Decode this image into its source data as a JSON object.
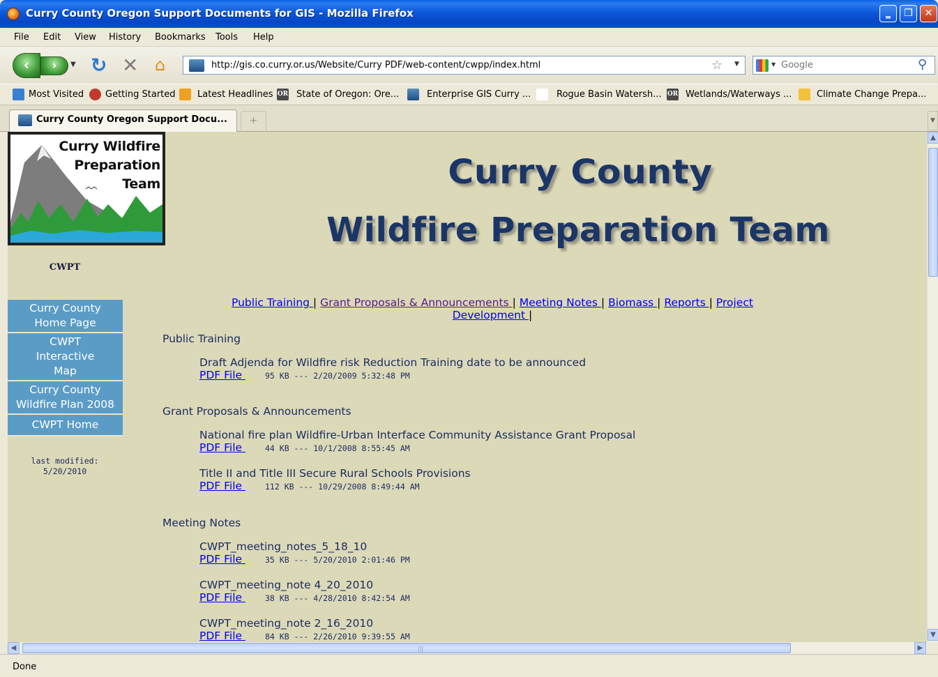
{
  "window": {
    "title": "Curry County Oregon Support Documents for GIS - Mozilla Firefox",
    "minimize": "‗",
    "maximize": "❐",
    "close": "✕"
  },
  "menu": [
    "File",
    "Edit",
    "View",
    "History",
    "Bookmarks",
    "Tools",
    "Help"
  ],
  "nav": {
    "url": "http://gis.co.curry.or.us/Website/Curry PDF/web-content/cwpp/index.html",
    "search_placeholder": "Google"
  },
  "bookmarks": [
    {
      "label": "Most Visited",
      "icon": "most-visited-icon"
    },
    {
      "label": "Getting Started",
      "icon": "firefox-icon"
    },
    {
      "label": "Latest Headlines",
      "icon": "rss-icon"
    },
    {
      "label": "State of Oregon: Ore...",
      "icon": "oregon-icon"
    },
    {
      "label": "Enterprise GIS Curry ...",
      "icon": "gis-icon"
    },
    {
      "label": "Rogue Basin Watersh...",
      "icon": "blank-icon"
    },
    {
      "label": "Wetlands/Waterways ...",
      "icon": "oregon-icon"
    },
    {
      "label": "Climate Change Prepa...",
      "icon": "climate-icon"
    }
  ],
  "tabs": [
    {
      "label": "Curry County Oregon Support Docu...",
      "active": true
    }
  ],
  "page": {
    "logo": {
      "line1": "Curry Wildfire",
      "line2": "Preparation",
      "line3": "Team"
    },
    "cwpt_label": "CWPT",
    "left_nav": [
      "Curry County Home Page",
      "CWPT Interactive Map",
      "Curry County Wildfire Plan 2008",
      "CWPT Home"
    ],
    "last_modified_label": "last modified:",
    "last_modified_date": "5/20/2010",
    "heading_line1": "Curry County",
    "heading_line2": "Wildfire Preparation Team",
    "top_nav": [
      "Public Training ",
      "Grant Proposals & Announcements ",
      "Meeting Notes ",
      "Biomass ",
      "Reports ",
      "Project Development "
    ],
    "separator": "|",
    "sections": [
      {
        "title": "Public Training",
        "docs": [
          {
            "title": "Draft Adjenda for Wildfire risk Reduction Training date to be announced",
            "link": "PDF File ",
            "meta": "95 KB --- 2/20/2009 5:32:48 PM"
          }
        ]
      },
      {
        "title": "Grant Proposals & Announcements",
        "docs": [
          {
            "title": "National fire plan Wildfire-Urban Interface Community Assistance Grant Proposal",
            "link": "PDF File ",
            "meta": "44 KB --- 10/1/2008 8:55:45 AM"
          },
          {
            "title": "Title II and Title III Secure Rural Schools Provisions",
            "link": "PDF File ",
            "meta": "112 KB --- 10/29/2008 8:49:44 AM"
          }
        ]
      },
      {
        "title": "Meeting Notes",
        "docs": [
          {
            "title": "CWPT_meeting_notes_5_18_10",
            "link": "PDF File ",
            "meta": "35 KB --- 5/20/2010 2:01:46 PM"
          },
          {
            "title": "CWPT_meeting_note 4_20_2010",
            "link": "PDF File ",
            "meta": "38 KB --- 4/28/2010 8:42:54 AM"
          },
          {
            "title": "CWPT_meeting_note 2_16_2010",
            "link": "PDF File ",
            "meta": "84 KB --- 2/26/2010 9:39:55 AM"
          }
        ]
      }
    ]
  },
  "status": "Done",
  "colors": {
    "page_bg": "#DCD9B8",
    "heading": "#1B3666",
    "nav_button": "#5B9CC7",
    "link": "#0000EE",
    "visited_link": "#551A8B"
  }
}
